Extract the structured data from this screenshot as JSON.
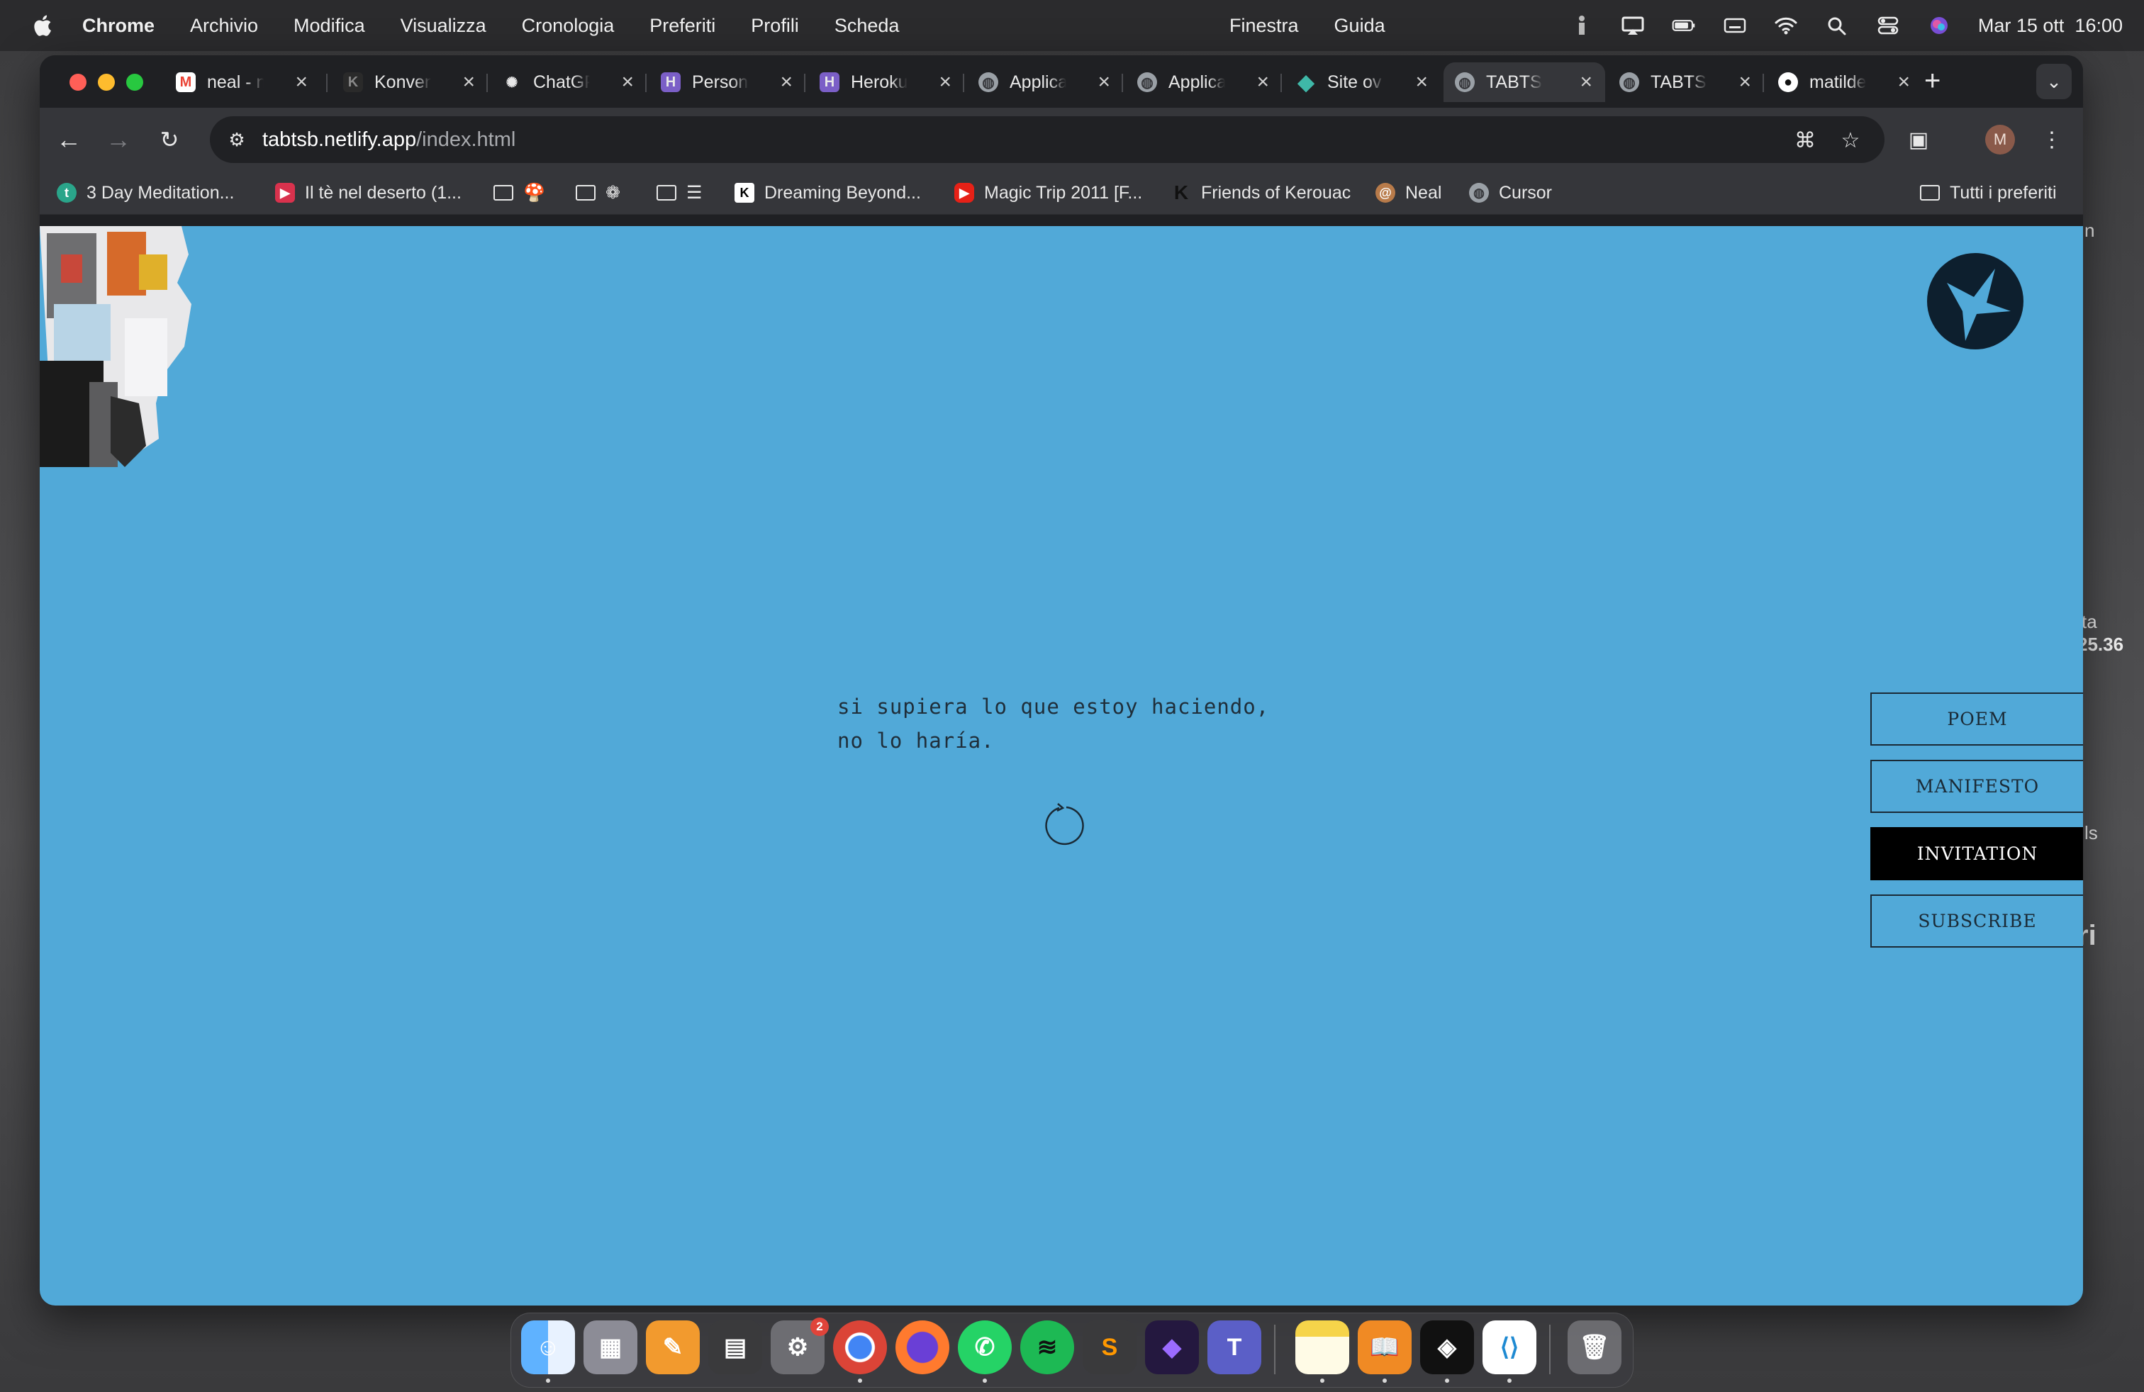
{
  "menubar": {
    "app_name": "Chrome",
    "items": [
      "Archivio",
      "Modifica",
      "Visualizza",
      "Cronologia",
      "Preferiti",
      "Profili",
      "Scheda"
    ],
    "window_items": [
      "Finestra",
      "Guida"
    ],
    "datetime": "Mar 15 ott  16:00"
  },
  "tabs": [
    {
      "title": "neal - n",
      "icon": "gmail-icon"
    },
    {
      "title": "Konven",
      "icon": "konven-icon"
    },
    {
      "title": "ChatGP",
      "icon": "chatgpt-icon"
    },
    {
      "title": "Person",
      "icon": "heroku-icon"
    },
    {
      "title": "Heroku",
      "icon": "heroku-icon"
    },
    {
      "title": "Applica",
      "icon": "globe-icon"
    },
    {
      "title": "Applica",
      "icon": "globe-icon"
    },
    {
      "title": "Site ov",
      "icon": "netlify-icon"
    },
    {
      "title": "TABTSB",
      "icon": "globe-icon",
      "active": true
    },
    {
      "title": "TABTSB",
      "icon": "globe-icon"
    },
    {
      "title": "matilde",
      "icon": "github-icon"
    }
  ],
  "address_bar": {
    "host": "tabtsb.netlify.app",
    "path": "/index.html"
  },
  "profile_initial": "M",
  "bookmarks": [
    {
      "label": "3 Day Meditation...",
      "icon": "meditation-icon",
      "color": "#2aa58a"
    },
    {
      "label": "Il tè nel deserto (1...",
      "icon": "video-icon",
      "color": "#d9324d"
    },
    {
      "label": "",
      "icon": "folder-icon"
    },
    {
      "label": "",
      "icon": "folder-icon"
    },
    {
      "label": "",
      "icon": "folder-icon"
    },
    {
      "label": "Dreaming Beyond...",
      "icon": "k-icon"
    },
    {
      "label": "Magic Trip 2011 [F...",
      "icon": "youtube-icon",
      "color": "#e62117"
    },
    {
      "label": "Friends of Kerouac",
      "icon": "k-icon"
    },
    {
      "label": "Neal",
      "icon": "spiral-icon"
    },
    {
      "label": "Cursor",
      "icon": "globe-icon"
    }
  ],
  "bookmarks_all": "Tutti i preferiti",
  "page": {
    "background": "#51a9d8",
    "quote_line1": "si supiera lo que estoy haciendo,",
    "quote_line2": "no lo haría.",
    "nav": [
      {
        "label": "POEM",
        "active": false
      },
      {
        "label": "MANIFESTO",
        "active": false
      },
      {
        "label": "INVITATION",
        "active": true
      },
      {
        "label": "SUBSCRIBE",
        "active": false
      }
    ]
  },
  "desktop_fragments": [
    "n",
    "ta",
    "25.36",
    "ls",
    "ri"
  ],
  "dock": [
    {
      "name": "finder",
      "color": "#2f8cf0",
      "running": true
    },
    {
      "name": "launchpad",
      "color": "#8c8c96",
      "running": false
    },
    {
      "name": "pages",
      "color": "#f29a2e",
      "running": false
    },
    {
      "name": "calculator",
      "color": "#3a3a3c",
      "running": false
    },
    {
      "name": "system-settings",
      "color": "#6d6d72",
      "running": false,
      "badge": "2"
    },
    {
      "name": "chrome",
      "color": "#e8e8e8",
      "running": true
    },
    {
      "name": "firefox",
      "color": "#6a3fd6",
      "running": false
    },
    {
      "name": "whatsapp",
      "color": "#25d366",
      "running": true
    },
    {
      "name": "spotify",
      "color": "#1db954",
      "running": false
    },
    {
      "name": "sublime-text",
      "color": "#ff9800",
      "running": false
    },
    {
      "name": "obsidian",
      "color": "#7c4dff",
      "running": false
    },
    {
      "name": "teams",
      "color": "#5b5fc7",
      "running": false
    },
    {
      "name": "notes",
      "color": "#f6d44a",
      "running": true
    },
    {
      "name": "books",
      "color": "#f08a24",
      "running": true
    },
    {
      "name": "unity",
      "color": "#111111",
      "running": true
    },
    {
      "name": "vscode",
      "color": "#1f8ad2",
      "running": true
    },
    {
      "name": "trash",
      "color": "#9a9aa0",
      "running": false
    }
  ]
}
